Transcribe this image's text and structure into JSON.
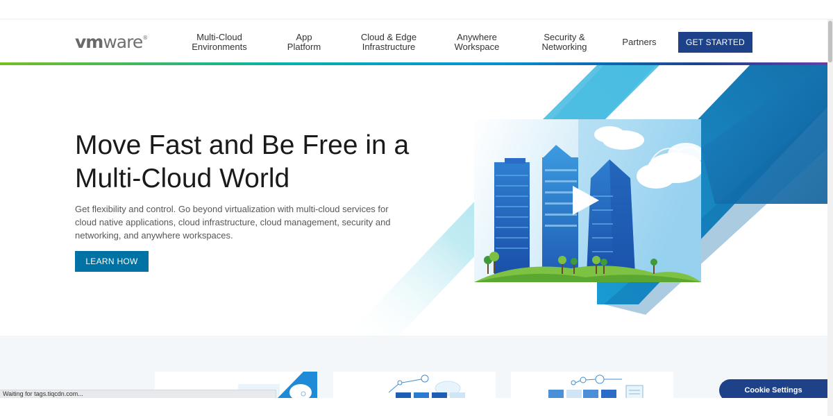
{
  "header": {
    "logo_bold": "vm",
    "logo_rest": "ware",
    "logo_mark": "®",
    "nav": [
      {
        "label": "Multi-Cloud\nEnvironments"
      },
      {
        "label": "App\nPlatform"
      },
      {
        "label": "Cloud & Edge\nInfrastructure"
      },
      {
        "label": "Anywhere\nWorkspace"
      },
      {
        "label": "Security &\nNetworking"
      },
      {
        "label": "Partners"
      }
    ],
    "cta_label": "GET STARTED"
  },
  "hero": {
    "title": "Move Fast and Be Free in a Multi-Cloud World",
    "description": "Get flexibility and control. Go beyond virtualization with multi-cloud services for cloud native applications, cloud infrastructure, cloud management, security and networking, and anywhere workspaces.",
    "button_label": "LEARN HOW",
    "video_icon": "play-icon"
  },
  "status_text": "Waiting for tags.tiqcdn.com...",
  "cookie_label": "Cookie Settings",
  "colors": {
    "brand_navy": "#1d428a",
    "button_blue": "#0072a3",
    "gradient": [
      "#78be20",
      "#00b2a9",
      "#0091da",
      "#1d428a",
      "#6a3da5"
    ]
  }
}
